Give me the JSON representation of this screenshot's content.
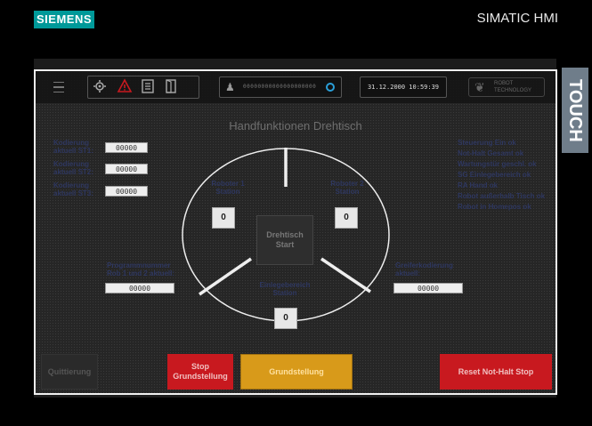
{
  "device": {
    "brand": "SIEMENS",
    "product": "SIMATIC HMI",
    "side_label": "TOUCH"
  },
  "toolbar": {
    "menu_icon": "hamburger-icon",
    "icons": [
      "settings-icon",
      "warning-icon",
      "list-icon",
      "door-icon"
    ],
    "status_text": "00000000000000000000",
    "datetime": "31.12.2000 10:59:39",
    "robot_logo": {
      "line1": "ROBOT",
      "line2": "TECHNOLOGY"
    }
  },
  "page": {
    "title": "Handfunktionen Drehtisch"
  },
  "codes": [
    {
      "label1": "Kodierung",
      "label2": "aktuell ST1:",
      "value": "00000"
    },
    {
      "label1": "Kodierung",
      "label2": "aktuell ST2:",
      "value": "00000"
    },
    {
      "label1": "Kodierung",
      "label2": "aktuell ST3:",
      "value": "00000"
    }
  ],
  "status_list": [
    "Steuerung Ein ok",
    "Not-Halt Gesamt ok",
    "Wartungstür geschl. ok",
    "SG Einlegebereich ok",
    "RA Hand ok",
    "Robot außerhalb Tisch ok",
    "Robot in Homepos ok"
  ],
  "stations": {
    "r1": {
      "line1": "Roboter 1",
      "line2": "Station",
      "value": "0"
    },
    "r2": {
      "line1": "Roboter 2",
      "line2": "Station",
      "value": "0"
    },
    "load": {
      "line1": "Einlegebereich",
      "line2": "Station",
      "value": "0"
    }
  },
  "start": {
    "line1": "Drehtisch",
    "line2": "Start"
  },
  "program": {
    "line1": "Programmnummer",
    "line2": "Rob 1 und 2 aktuell:",
    "value": "00000"
  },
  "gripper": {
    "line1": "Greiferkodierung",
    "line2": "aktuell:",
    "value": "00000"
  },
  "buttons": {
    "quit": "Quittierung",
    "stop_line1": "Stop",
    "stop_line2": "Grundstellung",
    "grund": "Grundstellung",
    "reset": "Reset Not-Halt Stop"
  },
  "colors": {
    "accent_red": "#c8191f",
    "accent_orange": "#d89a1a",
    "brand_teal": "#009999",
    "sync_blue": "#2a9fd8"
  }
}
